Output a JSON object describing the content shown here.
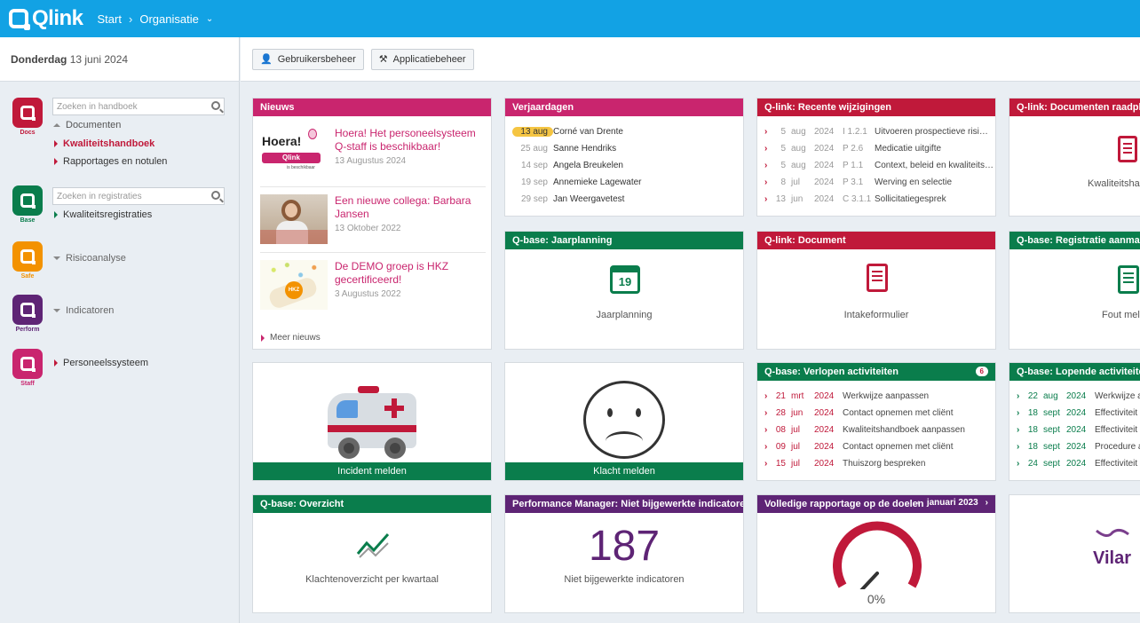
{
  "header": {
    "brand": "Qlink",
    "start": "Start",
    "org": "Organisatie"
  },
  "date": {
    "day": "Donderdag",
    "rest": "13 juni 2024"
  },
  "toolbar": {
    "users": "Gebruikersbeheer",
    "apps": "Applicatiebeheer"
  },
  "sidebar": {
    "docs_label": "Docs",
    "base_label": "Base",
    "safe_label": "Safe",
    "perform_label": "Perform",
    "staff_label": "Staff",
    "search_handbook": "Zoeken in handboek",
    "search_reg": "Zoeken in registraties",
    "documents": "Documenten",
    "kwaliteitshandboek": "Kwaliteitshandboek",
    "rapportages": "Rapportages en notulen",
    "kwaliteitsregistraties": "Kwaliteitsregistraties",
    "risicoanalyse": "Risicoanalyse",
    "indicatoren": "Indicatoren",
    "personeelssysteem": "Personeelssysteem"
  },
  "news": {
    "title": "Nieuws",
    "items": [
      {
        "title": "Hoera! Het personeelsysteem Q-staff is beschikbaar!",
        "date": "13 Augustus 2024",
        "thumb_text": "Hoera!",
        "thumb_brand": "Qlink",
        "thumb_sub": "is beschikbaar"
      },
      {
        "title": "Een nieuwe collega: Barbara Jansen",
        "date": "13 Oktober 2022"
      },
      {
        "title": "De DEMO groep is HKZ gecertificeerd!",
        "date": "3 Augustus 2022",
        "thumb_text": "HKZ"
      }
    ],
    "more": "Meer nieuws"
  },
  "birthdays": {
    "title": "Verjaardagen",
    "rows": [
      {
        "d": "13",
        "m": "aug",
        "name": "Corné van Drente"
      },
      {
        "d": "25",
        "m": "aug",
        "name": "Sanne Hendriks"
      },
      {
        "d": "14",
        "m": "sep",
        "name": "Angela Breukelen"
      },
      {
        "d": "19",
        "m": "sep",
        "name": "Annemieke Lagewater"
      },
      {
        "d": "29",
        "m": "sep",
        "name": "Jan Weergavetest"
      }
    ]
  },
  "recent": {
    "title": "Q-link: Recente wijzigingen",
    "rows": [
      {
        "d": "5",
        "m": "aug",
        "y": "2024",
        "code": "I 1.2.1",
        "text": "Uitvoeren prospectieve risi…"
      },
      {
        "d": "5",
        "m": "aug",
        "y": "2024",
        "code": "P 2.6",
        "text": "Medicatie uitgifte"
      },
      {
        "d": "5",
        "m": "aug",
        "y": "2024",
        "code": "P 1.1",
        "text": "Context, beleid en kwaliteits…"
      },
      {
        "d": "8",
        "m": "jul",
        "y": "2024",
        "code": "P 3.1",
        "text": "Werving en selectie"
      },
      {
        "d": "13",
        "m": "jun",
        "y": "2024",
        "code": "C 3.1.1",
        "text": "Sollicitatiegesprek"
      }
    ]
  },
  "docs_consult": {
    "title": "Q-link: Documenten raadplegen",
    "label": "Kwaliteitsha"
  },
  "jaarplanning": {
    "title": "Q-base: Jaarplanning",
    "label": "Jaarplanning",
    "cal": "19"
  },
  "document": {
    "title": "Q-link: Document",
    "label": "Intakeformulier"
  },
  "registratie": {
    "title": "Q-base: Registratie aanmaken",
    "label": "Fout mel"
  },
  "incident": {
    "label": "Incident melden"
  },
  "klacht": {
    "label": "Klacht melden"
  },
  "verlopen": {
    "title": "Q-base: Verlopen activiteiten",
    "badge": "6",
    "rows": [
      {
        "d": "21",
        "m": "mrt",
        "y": "2024",
        "text": "Werkwijze aanpassen"
      },
      {
        "d": "28",
        "m": "jun",
        "y": "2024",
        "text": "Contact opnemen met cliënt"
      },
      {
        "d": "08",
        "m": "jul",
        "y": "2024",
        "text": "Kwaliteitshandboek aanpassen"
      },
      {
        "d": "09",
        "m": "jul",
        "y": "2024",
        "text": "Contact opnemen met cliënt"
      },
      {
        "d": "15",
        "m": "jul",
        "y": "2024",
        "text": "Thuiszorg bespreken"
      }
    ]
  },
  "lopende": {
    "title": "Q-base: Lopende activiteiten",
    "rows": [
      {
        "d": "22",
        "m": "aug",
        "y": "2024",
        "text": "Werkwijze aa"
      },
      {
        "d": "18",
        "m": "sept",
        "y": "2024",
        "text": "Effectiviteit va"
      },
      {
        "d": "18",
        "m": "sept",
        "y": "2024",
        "text": "Effectiviteit va"
      },
      {
        "d": "18",
        "m": "sept",
        "y": "2024",
        "text": "Procedure aa"
      },
      {
        "d": "24",
        "m": "sept",
        "y": "2024",
        "text": "Effectiviteit va"
      }
    ]
  },
  "overzicht": {
    "title": "Q-base: Overzicht",
    "label": "Klachtenoverzicht per kwartaal"
  },
  "perf": {
    "title": "Performance Manager: Niet bijgewerkte indicatoren",
    "value": "187",
    "label": "Niet bijgewerkte indicatoren"
  },
  "rapportage": {
    "title": "Volledige rapportage op de doelen",
    "month": "januari 2023",
    "gauge_label": "0%",
    "gauge_value": 0
  },
  "vilans": {
    "text": "Vilar"
  },
  "colors": {
    "topbar": "#12a2e4",
    "red": "#c0193a",
    "pink": "#c9256e",
    "green": "#0a7d4c",
    "purple": "#5e2475",
    "orange": "#f39200"
  }
}
